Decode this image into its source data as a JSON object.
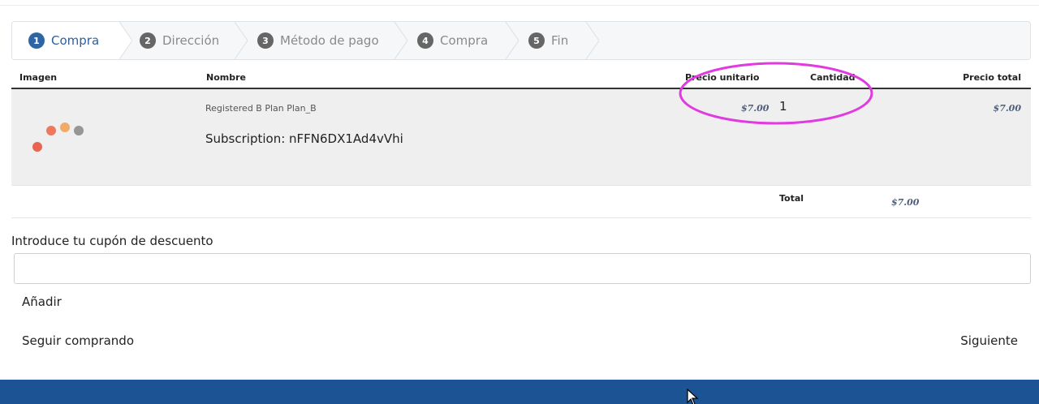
{
  "steps": [
    {
      "num": "1",
      "label": "Compra",
      "active": true
    },
    {
      "num": "2",
      "label": "Dirección",
      "active": false
    },
    {
      "num": "3",
      "label": "Método de pago",
      "active": false
    },
    {
      "num": "4",
      "label": "Compra",
      "active": false
    },
    {
      "num": "5",
      "label": "Fin",
      "active": false
    }
  ],
  "table": {
    "headers": {
      "image": "Imagen",
      "name": "Nombre",
      "unit_price": "Precio unitario",
      "quantity": "Cantidad",
      "total_price": "Precio total"
    },
    "rows": [
      {
        "plan": "Registered B Plan Plan_B",
        "subscription": "Subscription: nFFN6DX1Ad4vVhi",
        "unit_price": "$7.00",
        "quantity": "1",
        "total_price": "$7.00",
        "image_icon": "product-logo-icon"
      }
    ],
    "total": {
      "label": "Total",
      "value": "$7.00"
    }
  },
  "coupon": {
    "label": "Introduce tu cupón de descuento",
    "value": "",
    "add_label": "Añadir"
  },
  "actions": {
    "continue_shopping": "Seguir comprando",
    "next": "Siguiente"
  },
  "colors": {
    "accent": "#2d65a6",
    "footer": "#1c5395",
    "highlight": "#e03ae0"
  }
}
